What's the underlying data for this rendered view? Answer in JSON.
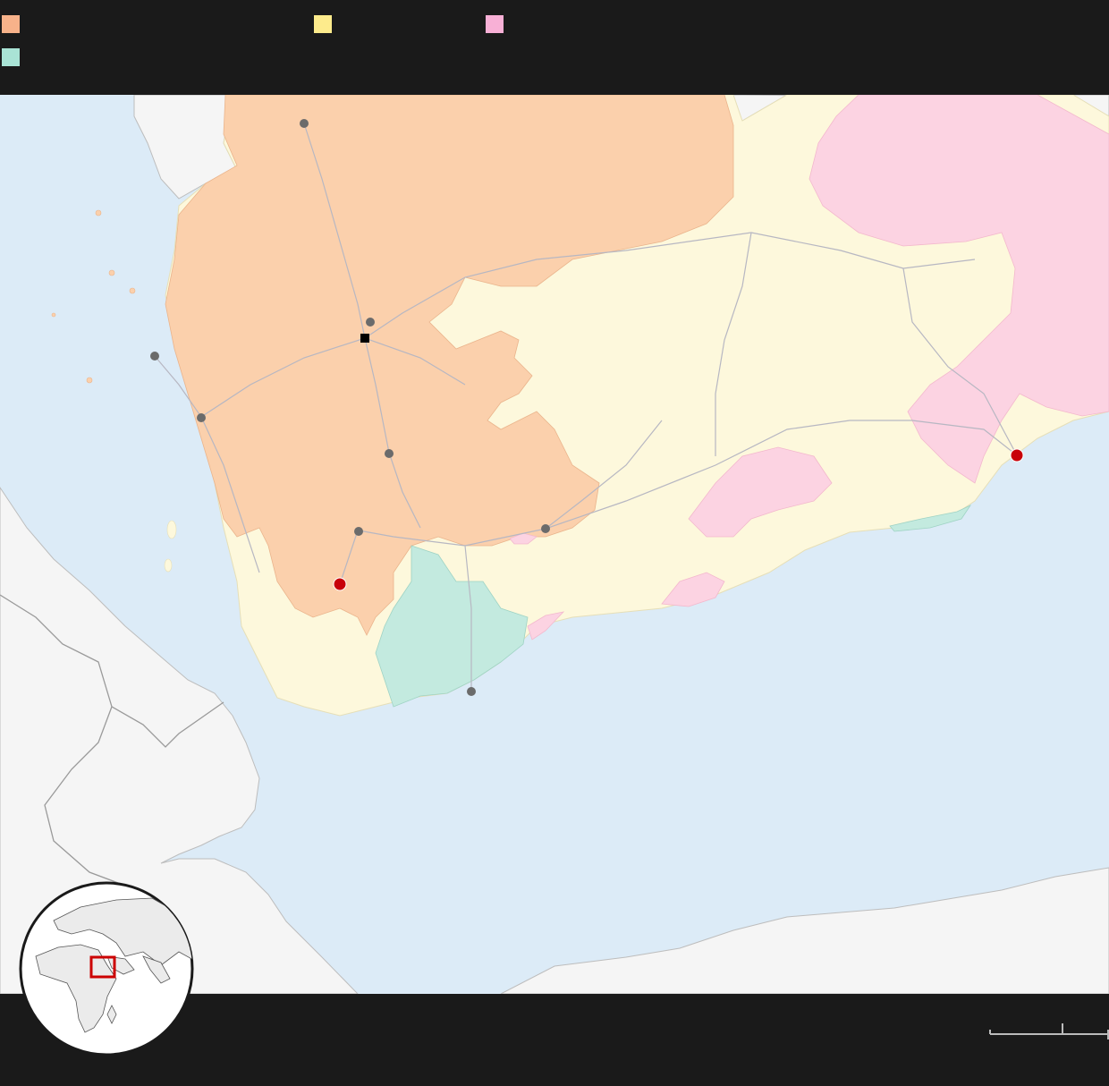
{
  "legend": {
    "items": [
      {
        "id": "zone-1",
        "color": "#f7b28a",
        "label": ""
      },
      {
        "id": "zone-2",
        "color": "#fdeb8c",
        "label": ""
      },
      {
        "id": "zone-3",
        "color": "#f8b0d6",
        "label": ""
      },
      {
        "id": "zone-4",
        "color": "#a9e3d5",
        "label": ""
      }
    ]
  },
  "map": {
    "colors": {
      "water": "#dcebf7",
      "land": "#f5f5f5",
      "zone_orange": "#fbd0ac",
      "zone_yellow": "#fdf8dc",
      "zone_pink": "#fcd3e2",
      "zone_teal": "#c3eadf",
      "border": "#9a9a9a",
      "road": "#b7b7c2",
      "city": "#6b6b6b",
      "capital": "#000000",
      "highlight_city": "#c8000a"
    }
  },
  "scale": {
    "label": ""
  },
  "inset": {
    "frame_color": "#cc0000"
  }
}
